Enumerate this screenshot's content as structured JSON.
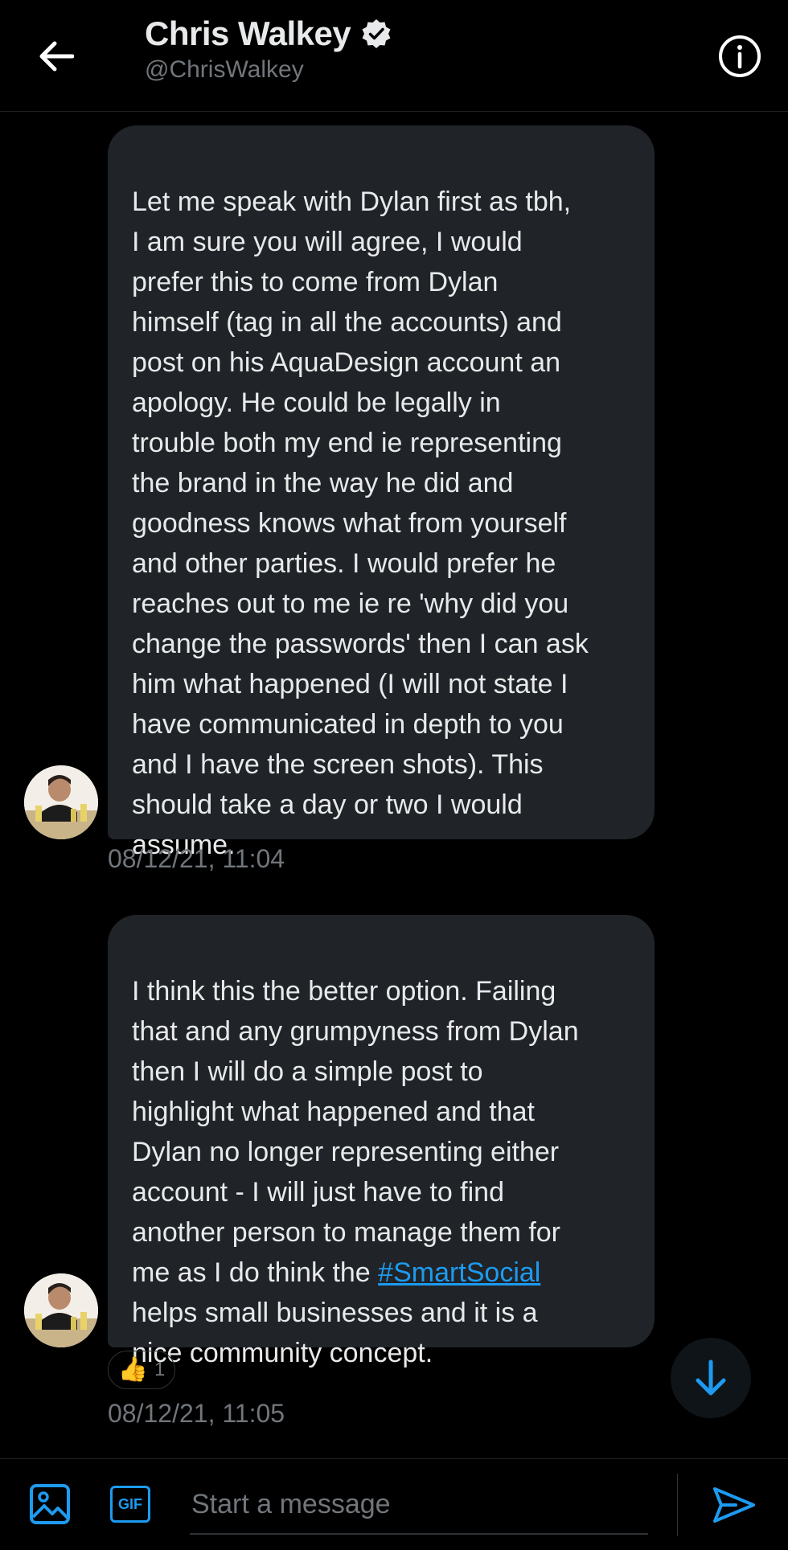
{
  "header": {
    "name": "Chris Walkey",
    "handle": "@ChrisWalkey",
    "back_icon": "arrow-left-icon",
    "info_icon": "info-icon",
    "verified_icon": "verified-badge-icon"
  },
  "messages": [
    {
      "text": "Let me speak with Dylan first as tbh,\nI am sure you will agree, I would\nprefer this to come from Dylan\nhimself (tag in all the accounts) and\npost on his AquaDesign account an\napology. He could be legally in\ntrouble both my end ie representing\nthe brand in the way he did and\ngoodness knows what from yourself\nand other parties. I would prefer he\nreaches out to me ie re 'why did you\nchange the passwords' then I can ask\nhim what happened (I will not state I\nhave communicated in depth to you\nand I have the screen shots). This\nshould take a day or two I would\nassume.",
      "timestamp": "08/12/21, 11:04"
    },
    {
      "text_before": "I think this the better option. Failing\nthat and any grumpyness from Dylan\nthen I will do a simple post to\nhighlight what happened and that\nDylan no longer representing either\naccount - I will just have to find\nanother person to manage them for\nme as I do think the ",
      "hashtag": "#SmartSocial",
      "text_after": "\nhelps small businesses and it is a\nnice community concept.",
      "reaction_emoji": "👍",
      "reaction_count": "1",
      "timestamp": "08/12/21, 11:05"
    }
  ],
  "composer": {
    "placeholder": "Start a message",
    "media_icon": "image-icon",
    "gif_label": "GIF",
    "send_icon": "send-icon"
  },
  "scroll_icon": "arrow-down-icon",
  "colors": {
    "accent": "#1d9bf0",
    "bubble": "#202327",
    "background": "#000000",
    "muted": "#71767b"
  }
}
